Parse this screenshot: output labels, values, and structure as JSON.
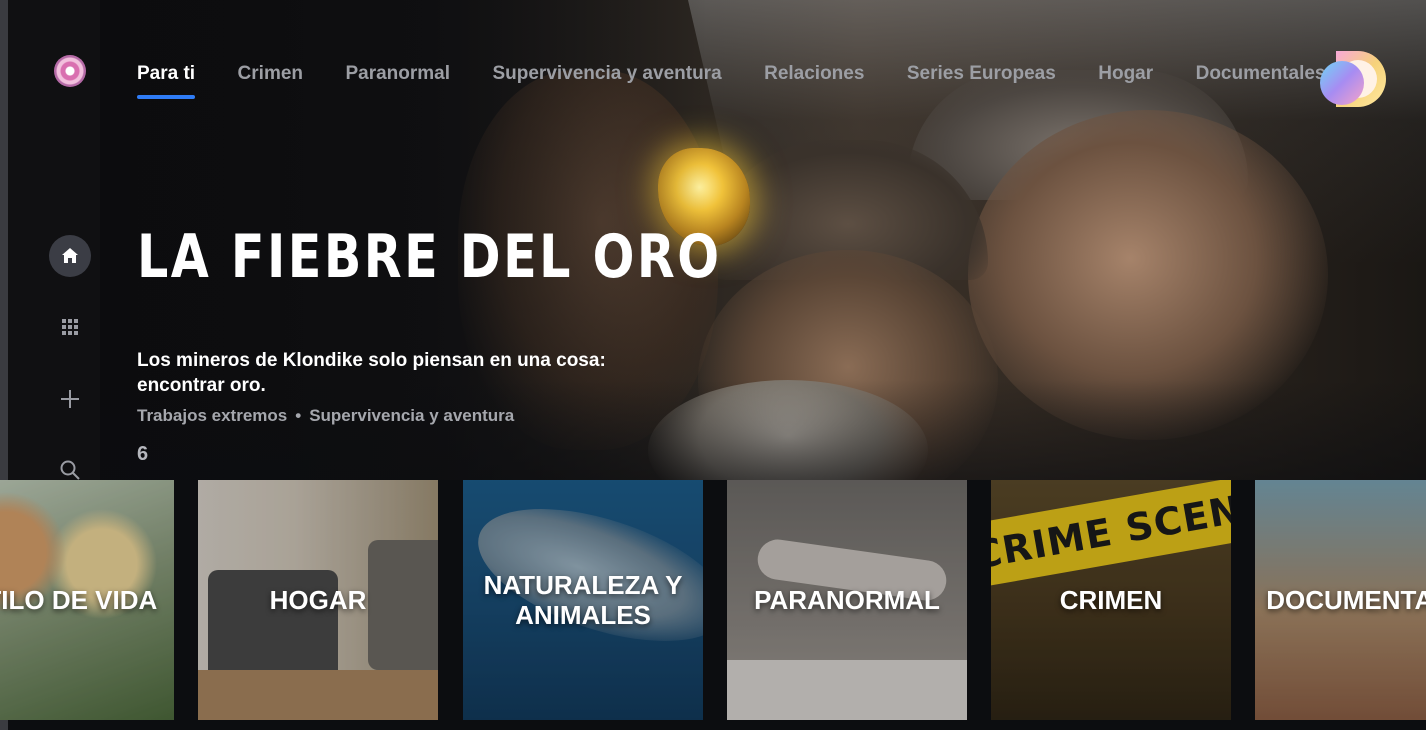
{
  "nav": {
    "tabs": [
      "Para ti",
      "Crimen",
      "Paranormal",
      "Supervivencia y aventura",
      "Relaciones",
      "Series Europeas",
      "Hogar",
      "Documentales"
    ],
    "active_tab": "Para ti"
  },
  "sidebar": {
    "items": [
      {
        "icon": "home-icon",
        "active": true
      },
      {
        "icon": "grid-icon",
        "active": false
      },
      {
        "icon": "plus-icon",
        "active": false
      },
      {
        "icon": "search-icon",
        "active": false
      }
    ]
  },
  "hero": {
    "title": "LA FIEBRE DEL ORO",
    "description": "Los mineros de Klondike solo piensan en una cosa: encontrar oro.",
    "genres": [
      "Trabajos extremos",
      "Supervivencia y aventura"
    ],
    "separator": "•",
    "age_rating": "6"
  },
  "categories": [
    {
      "label": "ESTILO DE VIDA"
    },
    {
      "label": "HOGAR"
    },
    {
      "label": "NATURALEZA Y ANIMALES"
    },
    {
      "label": "PARANORMAL"
    },
    {
      "label": "CRIMEN"
    },
    {
      "label": "DOCUMENTALES"
    }
  ],
  "crime_tape_text": "CRIME SCENE",
  "colors": {
    "accent": "#2f7cf6",
    "background": "#0c0d10",
    "inactive_text": "#9c9ea4"
  }
}
